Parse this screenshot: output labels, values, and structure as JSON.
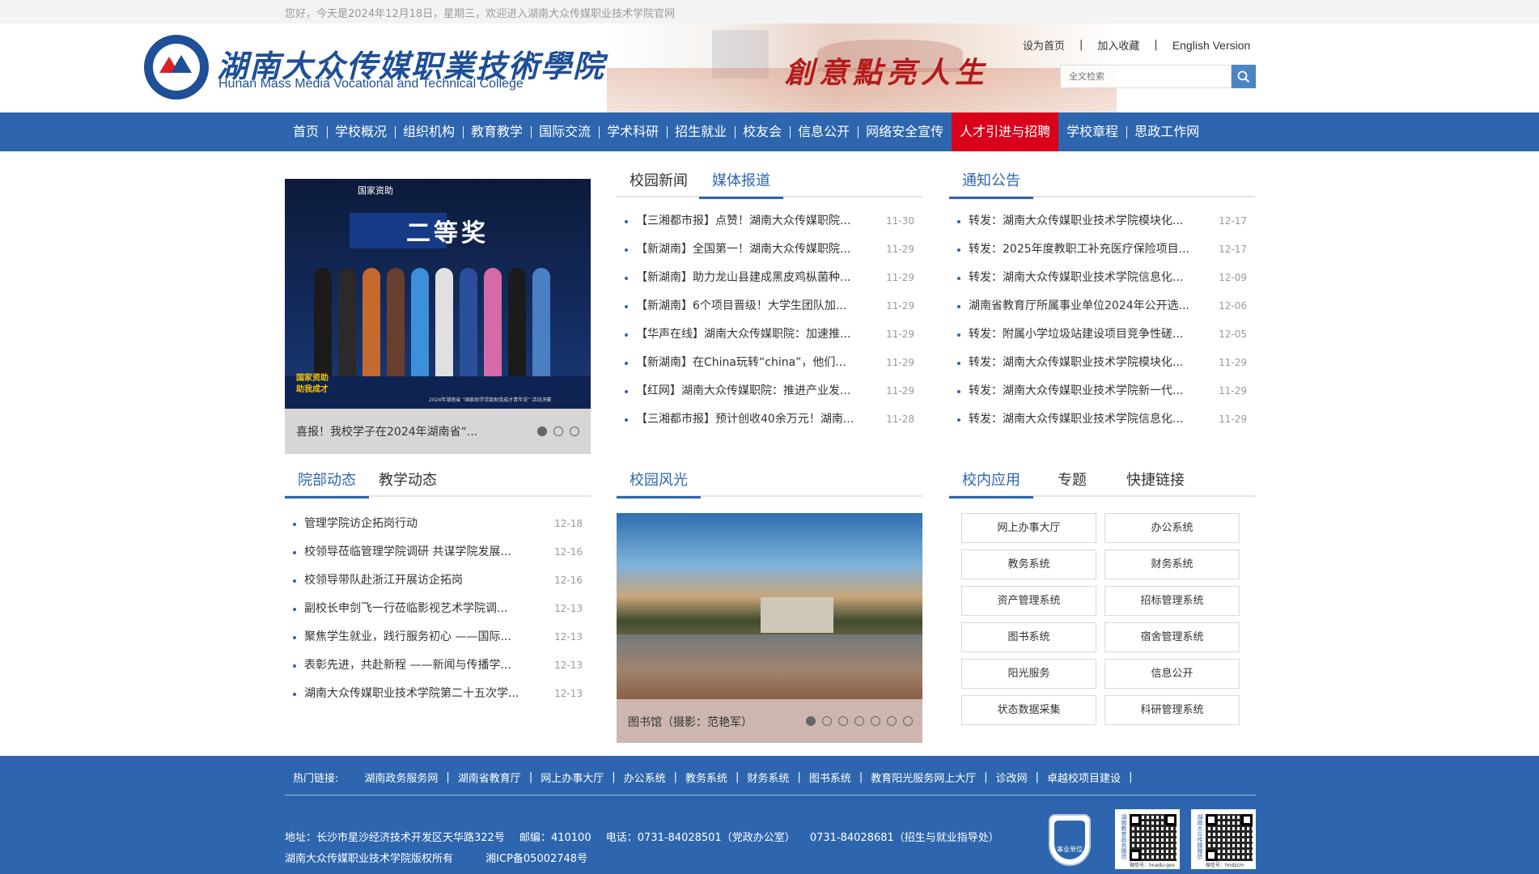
{
  "topbar": {
    "welcome": "您好，今天是2024年12月18日，星期三，欢迎进入湖南大众传媒职业技术学院官网"
  },
  "header": {
    "school_name_cn": "湖南大众传媒职業技術學院",
    "school_name_en": "Hunan Mass Media Vocational and Technical College",
    "slogan": "創意點亮人生",
    "links": [
      "设为首页",
      "加入收藏",
      "English Version"
    ],
    "search_placeholder": "全文检索"
  },
  "nav": {
    "items": [
      "首页",
      "学校概况",
      "组织机构",
      "教育教学",
      "国际交流",
      "学术科研",
      "招生就业",
      "校友会",
      "信息公开",
      "网络安全宣传",
      "人才引进与招聘",
      "学校章程",
      "思政工作网"
    ],
    "active": "人才引进与招聘",
    "active_color": "#d9001b",
    "bar_color": "#2d66ae"
  },
  "slider_top": {
    "caption": "喜报！我校学子在2024年湖南省“...",
    "photo_text": [
      "国家资助",
      "二等奖",
      "国家资助 助我成才",
      "2024年湖南省 “国家助学贷款助我成才青年说” 活动决赛"
    ],
    "dots": 3,
    "active_dot": 0
  },
  "news": {
    "tabs": [
      "校园新闻",
      "媒体报道"
    ],
    "active_tab": "媒体报道",
    "items": [
      {
        "title": "【三湘都市报】点赞！湖南大众传媒职院...",
        "date": "11-30"
      },
      {
        "title": "【新湖南】全国第一！湖南大众传媒职院...",
        "date": "11-29"
      },
      {
        "title": "【新湖南】助力龙山县建成黑皮鸡枞菌种...",
        "date": "11-29"
      },
      {
        "title": "【新湖南】6个项目晋级！大学生团队加...",
        "date": "11-29"
      },
      {
        "title": "【华声在线】湖南大众传媒职院：加速推...",
        "date": "11-29"
      },
      {
        "title": "【新湖南】在China玩转“china”，他们...",
        "date": "11-29"
      },
      {
        "title": "【红网】湖南大众传媒职院：推进产业发...",
        "date": "11-29"
      },
      {
        "title": "【三湘都市报】预计创收40余万元！湖南...",
        "date": "11-28"
      }
    ]
  },
  "notices": {
    "title": "通知公告",
    "items": [
      {
        "title": "转发：湖南大众传媒职业技术学院模块化...",
        "date": "12-17"
      },
      {
        "title": "转发：2025年度教职工补充医疗保险项目...",
        "date": "12-17"
      },
      {
        "title": "转发：湖南大众传媒职业技术学院信息化...",
        "date": "12-09"
      },
      {
        "title": "湖南省教育厅所属事业单位2024年公开选...",
        "date": "12-06"
      },
      {
        "title": "转发：附属小学垃圾站建设项目竞争性磋...",
        "date": "12-05"
      },
      {
        "title": "转发：湖南大众传媒职业技术学院模块化...",
        "date": "11-29"
      },
      {
        "title": "转发：湖南大众传媒职业技术学院新一代...",
        "date": "11-29"
      },
      {
        "title": "转发：湖南大众传媒职业技术学院信息化...",
        "date": "11-29"
      }
    ]
  },
  "dept": {
    "tabs": [
      "院部动态",
      "教学动态"
    ],
    "active_tab": "院部动态",
    "items": [
      {
        "title": "管理学院访企拓岗行动",
        "date": "12-18"
      },
      {
        "title": "校领导莅临管理学院调研 共谋学院发展...",
        "date": "12-16"
      },
      {
        "title": "校领导带队赴浙江开展访企拓岗",
        "date": "12-16"
      },
      {
        "title": "副校长申剑飞一行莅临影视艺术学院调...",
        "date": "12-13"
      },
      {
        "title": "聚焦学生就业，践行服务初心 ——国际...",
        "date": "12-13"
      },
      {
        "title": "表彰先进，共赴新程 ——新闻与传播学...",
        "date": "12-13"
      },
      {
        "title": "湖南大众传媒职业技术学院第二十五次学...",
        "date": "12-13"
      }
    ]
  },
  "campus": {
    "title": "校园风光",
    "caption": "图书馆（摄影：范艳军）",
    "dots": 7,
    "active_dot": 0
  },
  "apps": {
    "tabs": [
      "校内应用",
      "专题",
      "快捷链接"
    ],
    "active_tab": "校内应用",
    "items": [
      "网上办事大厅",
      "办公系统",
      "教务系统",
      "财务系统",
      "资产管理系统",
      "招标管理系统",
      "图书系统",
      "宿舍管理系统",
      "阳光服务",
      "信息公开",
      "状态数据采集",
      "科研管理系统"
    ]
  },
  "footer": {
    "hot_label": "热门链接:",
    "hot_links": [
      "湖南政务服务网",
      "湖南省教育厅",
      "网上办事大厅",
      "办公系统",
      "教务系统",
      "财务系统",
      "图书系统",
      "教育阳光服务网上大厅",
      "诊改网",
      "卓越校项目建设"
    ],
    "address": "地址：长沙市星沙经济技术开发区天华路322号",
    "postcode": "邮编：410100",
    "phone1": "电话：0731-84028501（党政办公室）",
    "phone2": "0731-84028681（招生与就业指导处）",
    "copyright": "湖南大众传媒职业技术学院版权所有",
    "icp": "湘ICP备05002748号",
    "badge_text": "事业单位",
    "qr1_label": "湖南教育政务微信",
    "qr1_sub": "微信号：hnedu-gov",
    "qr2_label": "湖南大众传媒微信",
    "qr2_sub": "微信号：hndzcm"
  }
}
